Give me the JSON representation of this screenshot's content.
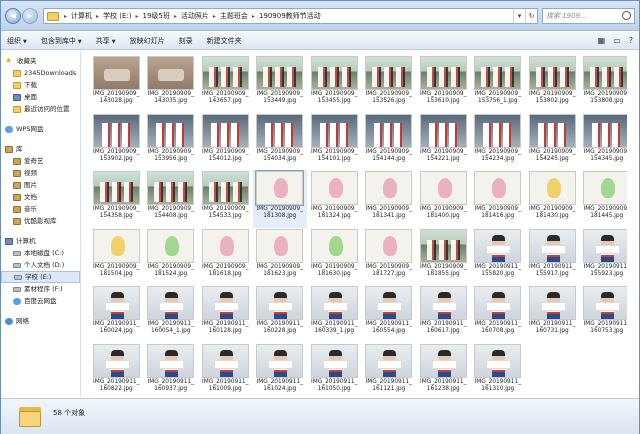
{
  "address": {
    "crumbs": [
      "计算机",
      "学校 (E:)",
      "19级5班",
      "活动照片",
      "主题班会",
      "190909教师节活动"
    ]
  },
  "search": {
    "placeholder": "搜索 1909..."
  },
  "toolbar": {
    "organize": "组织",
    "include_library": "包含到库中",
    "share": "共享",
    "slideshow": "放映幻灯片",
    "burn": "刻录",
    "new_folder": "新建文件夹"
  },
  "sidebar": {
    "favorites": {
      "label": "收藏夹",
      "items": [
        "2345Downloads",
        "下载",
        "桌面",
        "最近访问的位置"
      ]
    },
    "wps": "WPS网盘",
    "libraries": {
      "label": "库",
      "items": [
        "爱奇艺",
        "视频",
        "图片",
        "文档",
        "音乐",
        "优酷影视库"
      ]
    },
    "computer": {
      "label": "计算机",
      "items": [
        "本地磁盘 (C:)",
        "个人文档 (D:)",
        "学校 (E:)",
        "素材程序 (F:)",
        "百度云网盘"
      ]
    },
    "network": "网络"
  },
  "files": [
    {
      "l1": "IMG_20190909_",
      "l2": "143028.jpg",
      "kind": "gift"
    },
    {
      "l1": "IMG_20190909_",
      "l2": "143035.jpg",
      "kind": "gift"
    },
    {
      "l1": "IMG_20190909_",
      "l2": "143657.jpg",
      "kind": "group"
    },
    {
      "l1": "IMG_20190909_",
      "l2": "153449.jpg",
      "kind": "group"
    },
    {
      "l1": "IMG_20190909_",
      "l2": "153455.jpg",
      "kind": "group"
    },
    {
      "l1": "IMG_20190909_",
      "l2": "153526.jpg",
      "kind": "group"
    },
    {
      "l1": "IMG_20190909_",
      "l2": "153610.jpg",
      "kind": "group"
    },
    {
      "l1": "IMG_20190909_",
      "l2": "153756_1.jpg",
      "kind": "group"
    },
    {
      "l1": "IMG_20190909_",
      "l2": "153802.jpg",
      "kind": "group"
    },
    {
      "l1": "IMG_20190909_",
      "l2": "153808.jpg",
      "kind": "group"
    },
    {
      "l1": "IMG_20190909_",
      "l2": "153902.jpg",
      "kind": "kids"
    },
    {
      "l1": "IMG_20190909_",
      "l2": "153956.jpg",
      "kind": "kids"
    },
    {
      "l1": "IMG_20190909_",
      "l2": "154012.jpg",
      "kind": "kids"
    },
    {
      "l1": "IMG_20190909_",
      "l2": "154034.jpg",
      "kind": "kids"
    },
    {
      "l1": "IMG_20190909_",
      "l2": "154101.jpg",
      "kind": "kids"
    },
    {
      "l1": "IMG_20190909_",
      "l2": "154144.jpg",
      "kind": "kids"
    },
    {
      "l1": "IMG_20190909_",
      "l2": "154221.jpg",
      "kind": "kids"
    },
    {
      "l1": "IMG_20190909_",
      "l2": "154234.jpg",
      "kind": "kids"
    },
    {
      "l1": "IMG_20190909_",
      "l2": "154245.jpg",
      "kind": "kids"
    },
    {
      "l1": "IMG_20190909_",
      "l2": "154345.jpg",
      "kind": "kids"
    },
    {
      "l1": "IMG_20190909_",
      "l2": "154358.jpg",
      "kind": "group"
    },
    {
      "l1": "IMG_20190909_",
      "l2": "154408.jpg",
      "kind": "group"
    },
    {
      "l1": "IMG_20190909_",
      "l2": "154533.jpg",
      "kind": "group"
    },
    {
      "l1": "IMG_20190909_",
      "l2": "181308.jpg",
      "kind": "drawing",
      "selected": true
    },
    {
      "l1": "IMG_20190909_",
      "l2": "181324.jpg",
      "kind": "drawing"
    },
    {
      "l1": "IMG_20190909_",
      "l2": "181341.jpg",
      "kind": "drawing"
    },
    {
      "l1": "IMG_20190909_",
      "l2": "181400.jpg",
      "kind": "drawing"
    },
    {
      "l1": "IMG_20190909_",
      "l2": "181416.jpg",
      "kind": "drawing"
    },
    {
      "l1": "IMG_20190909_",
      "l2": "181430.jpg",
      "kind": "drawing-alt"
    },
    {
      "l1": "IMG_20190909_",
      "l2": "181445.jpg",
      "kind": "drawing-green"
    },
    {
      "l1": "IMG_20190909_",
      "l2": "181504.jpg",
      "kind": "drawing-alt"
    },
    {
      "l1": "IMG_20190909_",
      "l2": "181524.jpg",
      "kind": "drawing-green"
    },
    {
      "l1": "IMG_20190909_",
      "l2": "181618.jpg",
      "kind": "drawing"
    },
    {
      "l1": "IMG_20190909_",
      "l2": "181623.jpg",
      "kind": "drawing"
    },
    {
      "l1": "IMG_20190909_",
      "l2": "181630.jpg",
      "kind": "drawing-green"
    },
    {
      "l1": "IMG_20190909_",
      "l2": "181727.jpg",
      "kind": "drawing"
    },
    {
      "l1": "IMG_20190909_",
      "l2": "181855.jpg",
      "kind": "group"
    },
    {
      "l1": "IMG_20190911_",
      "l2": "155820.jpg",
      "kind": "portrait"
    },
    {
      "l1": "IMG_20190911_",
      "l2": "155917.jpg",
      "kind": "portrait"
    },
    {
      "l1": "IMG_20190911_",
      "l2": "155923.jpg",
      "kind": "portrait"
    },
    {
      "l1": "IMG_20190911_",
      "l2": "160024.jpg",
      "kind": "portrait"
    },
    {
      "l1": "IMG_20190911_",
      "l2": "160054_1.jpg",
      "kind": "portrait"
    },
    {
      "l1": "IMG_20190911_",
      "l2": "160128.jpg",
      "kind": "portrait"
    },
    {
      "l1": "IMG_20190911_",
      "l2": "160228.jpg",
      "kind": "portrait"
    },
    {
      "l1": "IMG_20190911_",
      "l2": "160339_1.jpg",
      "kind": "portrait"
    },
    {
      "l1": "IMG_20190911_",
      "l2": "160554.jpg",
      "kind": "portrait"
    },
    {
      "l1": "IMG_20190911_",
      "l2": "160617.jpg",
      "kind": "portrait"
    },
    {
      "l1": "IMG_20190911_",
      "l2": "160708.jpg",
      "kind": "portrait"
    },
    {
      "l1": "IMG_20190911_",
      "l2": "160731.jpg",
      "kind": "portrait"
    },
    {
      "l1": "IMG_20190911_",
      "l2": "160753.jpg",
      "kind": "portrait"
    },
    {
      "l1": "IMG_20190911_",
      "l2": "160822.jpg",
      "kind": "portrait"
    },
    {
      "l1": "IMG_20190911_",
      "l2": "160937.jpg",
      "kind": "portrait"
    },
    {
      "l1": "IMG_20190911_",
      "l2": "161009.jpg",
      "kind": "portrait"
    },
    {
      "l1": "IMG_20190911_",
      "l2": "161024.jpg",
      "kind": "portrait"
    },
    {
      "l1": "IMG_20190911_",
      "l2": "161050.jpg",
      "kind": "portrait"
    },
    {
      "l1": "IMG_20190911_",
      "l2": "161121.jpg",
      "kind": "portrait"
    },
    {
      "l1": "IMG_20190911_",
      "l2": "161238.jpg",
      "kind": "portrait"
    },
    {
      "l1": "IMG_20190911_",
      "l2": "161310.jpg",
      "kind": "portrait"
    }
  ],
  "status": {
    "count": "58 个对象"
  },
  "colors": {
    "chrome_top": "#d7e6f6",
    "selection": "#dce8f7",
    "folder": "#f2cd68"
  }
}
